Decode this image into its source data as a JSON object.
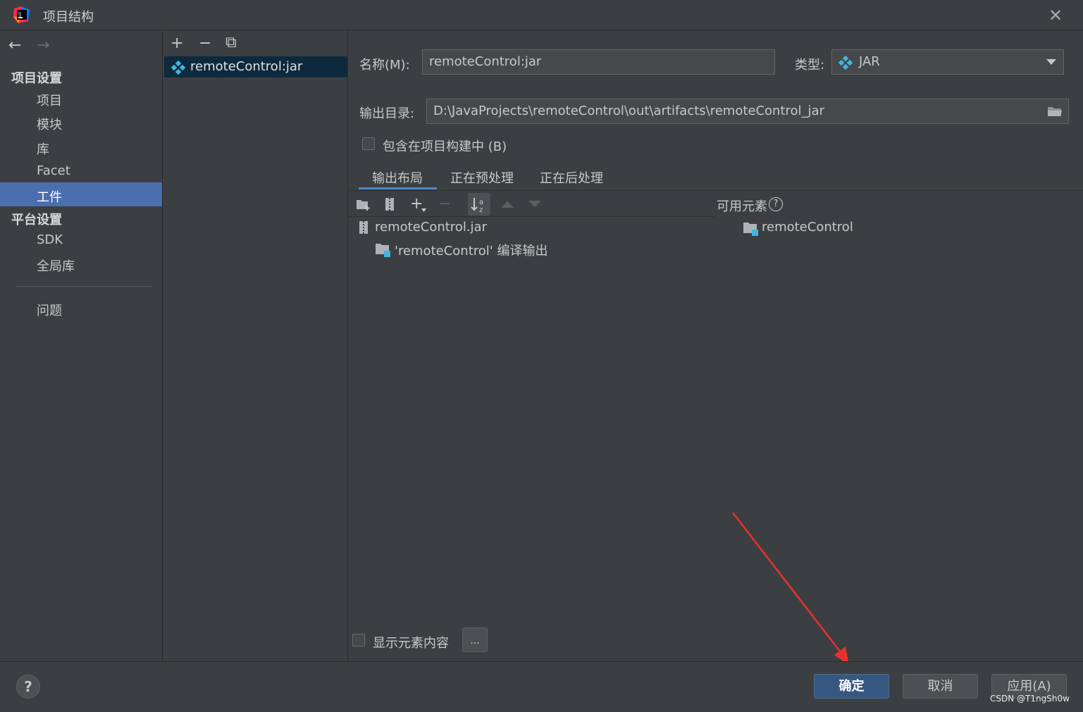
{
  "window": {
    "title": "项目结构",
    "close_label": "✕"
  },
  "nav": {
    "back_label": "←",
    "forward_label": "→"
  },
  "sidebar": {
    "sections": [
      {
        "title": "项目设置",
        "items": [
          "项目",
          "模块",
          "库",
          "Facet",
          "工件"
        ]
      },
      {
        "title": "平台设置",
        "items": [
          "SDK",
          "全局库"
        ]
      }
    ],
    "problems_label": "问题",
    "selected_item": "工件"
  },
  "artifacts_list": {
    "toolbar": {
      "add": "+",
      "remove": "−",
      "copy": "⧉"
    },
    "items": [
      {
        "label": "remoteControl:jar"
      }
    ]
  },
  "details": {
    "name_label": "名称(M):",
    "name_value": "remoteControl:jar",
    "type_label": "类型:",
    "type_value": "JAR",
    "output_dir_label": "输出目录:",
    "output_dir_value": "D:\\JavaProjects\\remoteControl\\out\\artifacts\\remoteControl_jar",
    "include_in_build_label": "包含在项目构建中 (B)",
    "include_in_build_checked": false,
    "tabs": [
      "输出布局",
      "正在预处理",
      "正在后处理"
    ],
    "active_tab": "输出布局"
  },
  "layout_tree": {
    "root": "remoteControl.jar",
    "children": [
      "'remoteControl' 编译输出"
    ]
  },
  "available": {
    "header": "可用元素",
    "help_icon": "?",
    "items": [
      "remoteControl"
    ]
  },
  "show_content": {
    "label": "显示元素内容",
    "checked": false,
    "ellipsis_button": "..."
  },
  "footer": {
    "help_label": "?",
    "ok_label": "确定",
    "cancel_label": "取消",
    "apply_label": "应用(A)",
    "watermark": "CSDN @T1ngSh0w"
  },
  "colors": {
    "selection": "#4b6eaf",
    "list_selection": "#0d293e",
    "annotation_arrow": "#e8322d"
  }
}
